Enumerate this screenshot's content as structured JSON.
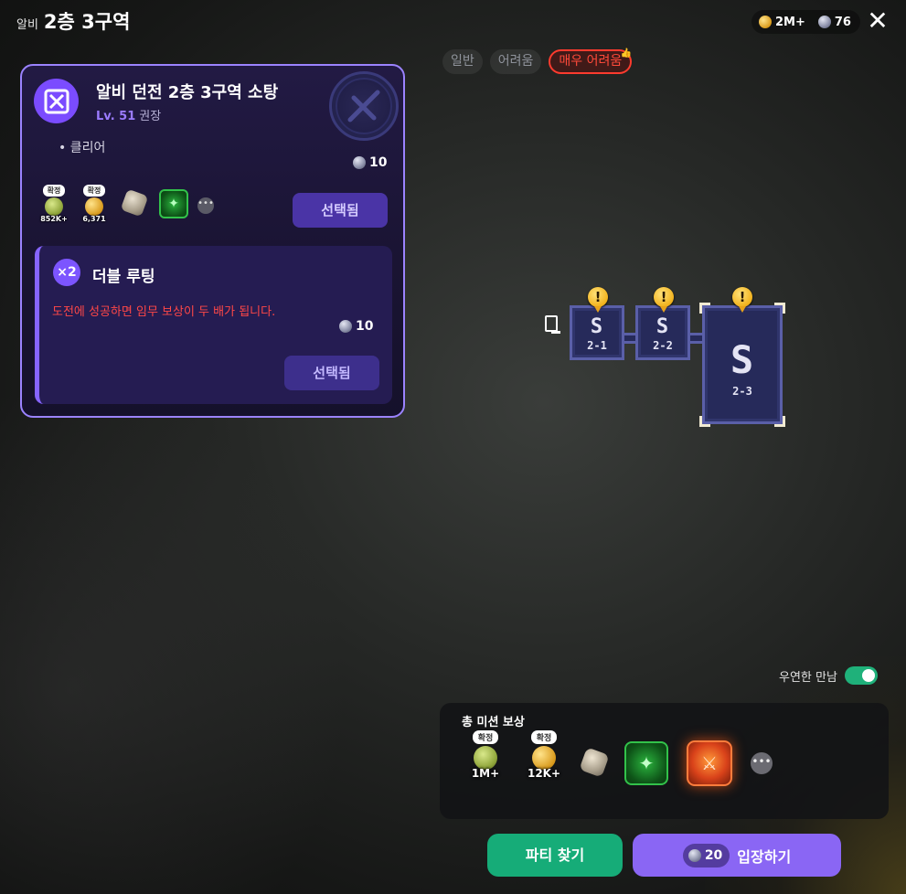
{
  "header": {
    "subtitle": "알비",
    "title": "2층 3구역",
    "gold_amount": "2M+",
    "stone_amount": "76",
    "close_label": "✕"
  },
  "difficulty": {
    "tabs": [
      {
        "label": "일반",
        "active": false
      },
      {
        "label": "어려움",
        "active": false
      },
      {
        "label": "매우 어려움",
        "active": true
      }
    ],
    "active_color": "#ff3b2e"
  },
  "mission_card": {
    "title": "알비 던전 2층 3구역 소탕",
    "level": "Lv. 51",
    "level_suffix": "권장",
    "objective": "• 클리어",
    "cost": "10",
    "rewards": [
      {
        "icon": "ticket-icon",
        "badge": "확정",
        "amount": "852K+"
      },
      {
        "icon": "gold-coin-icon",
        "badge": "확정",
        "amount": "6,371"
      },
      {
        "icon": "ore-icon"
      },
      {
        "icon": "green-crystal-icon"
      },
      {
        "icon": "more-icon"
      }
    ],
    "select_label": "선택됨",
    "accent": "#9b83ff"
  },
  "double_loot": {
    "badge": "×2",
    "title": "더블 루팅",
    "description": "도전에 성공하면 임무 보상이 두 배가 됩니다.",
    "cost": "10",
    "select_label": "선택됨"
  },
  "map": {
    "rooms": [
      {
        "glyph": "S",
        "label": "2-1",
        "alert": "!"
      },
      {
        "glyph": "S",
        "label": "2-2",
        "alert": "!"
      },
      {
        "glyph": "S",
        "label": "2-3",
        "alert": "!"
      }
    ]
  },
  "encounter": {
    "label": "우연한 만남",
    "enabled": true,
    "color": "#1fb17a"
  },
  "total_rewards": {
    "title": "총 미션 보상",
    "items": [
      {
        "icon": "ticket-icon",
        "badge": "확정",
        "amount": "1M+"
      },
      {
        "icon": "gold-coin-icon",
        "badge": "확정",
        "amount": "12K+"
      },
      {
        "icon": "ore-icon"
      },
      {
        "icon": "green-crystal-icon"
      },
      {
        "icon": "fire-weapon-icon"
      },
      {
        "icon": "more-icon"
      }
    ]
  },
  "actions": {
    "party_label": "파티 찾기",
    "enter_label": "입장하기",
    "enter_cost": "20",
    "party_color": "#16ac78",
    "enter_color": "#8a66f4"
  }
}
